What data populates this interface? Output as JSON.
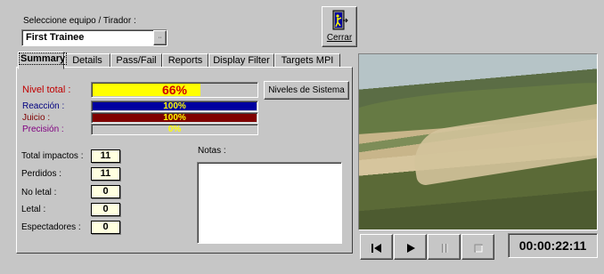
{
  "selector": {
    "label": "Seleccione equipo / Tirador :",
    "value": "First Trainee",
    "dropdown_icon": "dotted-dropdown-icon"
  },
  "close": {
    "label": "Cerrar",
    "icon": "door-exit-icon"
  },
  "tabs": [
    {
      "label": "Summary",
      "active": true
    },
    {
      "label": "Details",
      "active": false
    },
    {
      "label": "Pass/Fail",
      "active": false
    },
    {
      "label": "Reports",
      "active": false
    },
    {
      "label": "Display Filter",
      "active": false
    },
    {
      "label": "Targets MPI",
      "active": false
    }
  ],
  "summary": {
    "nivel_total": {
      "label": "Nivel total :",
      "value": "66%",
      "fraction": 0.66,
      "color": "#ffff00"
    },
    "reaccion": {
      "label": "Reacción :",
      "value": "100%",
      "fraction": 1.0,
      "color": "#0000a0"
    },
    "juicio": {
      "label": "Juicio :",
      "value": "100%",
      "fraction": 1.0,
      "color": "#800000"
    },
    "precision": {
      "label": "Precisión :",
      "value": "0%",
      "fraction": 0.0,
      "color": "#800080"
    },
    "niveles_button": "Niveles de Sistema"
  },
  "stats": [
    {
      "label": "Total impactos :",
      "value": "11"
    },
    {
      "label": "Perdidos :",
      "value": "11"
    },
    {
      "label": "No letal :",
      "value": "0"
    },
    {
      "label": "Letal :",
      "value": "0"
    },
    {
      "label": "Espectadores :",
      "value": "0"
    }
  ],
  "notes": {
    "label": "Notas :",
    "value": ""
  },
  "transport": {
    "buttons": [
      "skip-to-start-icon",
      "play-icon",
      "pause-icon",
      "stop-icon"
    ],
    "timecode": "00:00:22:11"
  },
  "colors": {
    "nivel_label": "#c00000",
    "precision_label": "#800080",
    "reaccion_label": "#000080",
    "juicio_label": "#800000"
  }
}
